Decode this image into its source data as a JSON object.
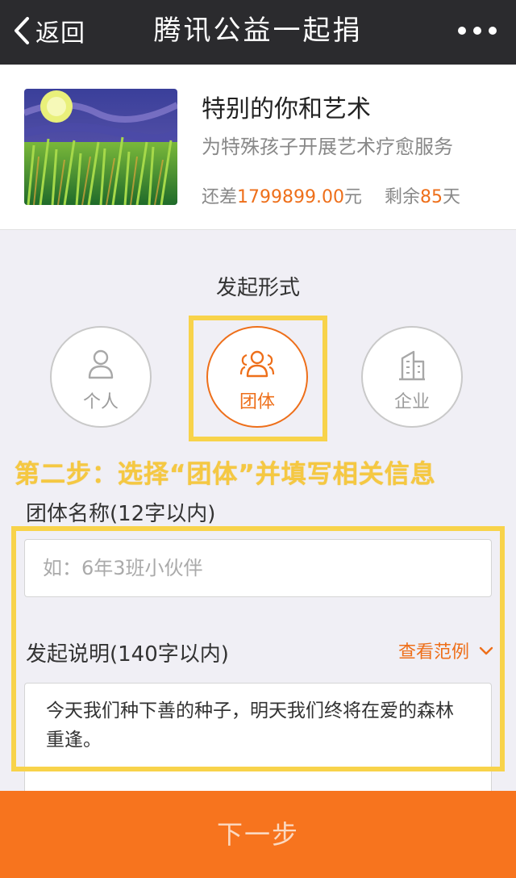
{
  "navbar": {
    "back_label": "返回",
    "title": "腾讯公益一起捐"
  },
  "project": {
    "title": "特别的你和艺术",
    "subtitle": "为特殊孩子开展艺术疗愈服务",
    "remaining_prefix": "还差",
    "remaining_amount": "1799899.00",
    "remaining_unit": "元",
    "days_prefix": "剩余",
    "days_value": "85",
    "days_unit": "天"
  },
  "launch": {
    "section_title": "发起形式",
    "options": [
      {
        "label": "个人",
        "icon": "person-icon",
        "selected": false
      },
      {
        "label": "团体",
        "icon": "group-icon",
        "selected": true
      },
      {
        "label": "企业",
        "icon": "building-icon",
        "selected": false
      }
    ]
  },
  "annotation": {
    "step_text": "第二步：选择“团体”并填写相关信息"
  },
  "form": {
    "group_name_label": "团体名称(12字以内)",
    "group_name_placeholder": "如：6年3班小伙伴",
    "group_name_value": "",
    "description_label": "发起说明(140字以内)",
    "example_link": "查看范例",
    "description_value": "今天我们种下善的种子，明天我们终将在爱的森林重逢。"
  },
  "footer": {
    "next_label": "下一步"
  },
  "colors": {
    "accent": "#ee6f1a",
    "navbar": "#2b2b2e",
    "annotation": "#f8d34a",
    "button": "#f7741e"
  }
}
